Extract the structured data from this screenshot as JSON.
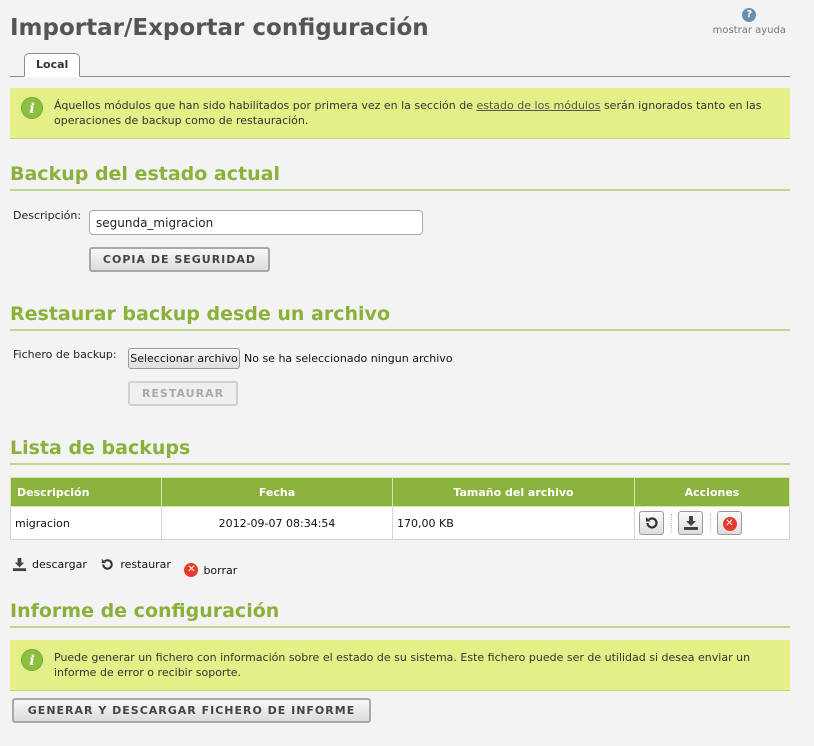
{
  "page": {
    "title": "Importar/Exportar configuración"
  },
  "help": {
    "icon": "help-icon",
    "label": "mostrar ayuda"
  },
  "tabs": [
    {
      "label": "Local"
    }
  ],
  "notice_modules": {
    "icon": "info-icon",
    "text_before": "Áquellos módulos que han sido habilitados por primera vez en la sección de ",
    "link": "estado de los módulos",
    "text_after": " serán ignorados tanto en las operaciones de backup como de restauración."
  },
  "backup": {
    "title": "Backup del estado actual",
    "description_label": "Descripción:",
    "description_value": "segunda_migracion",
    "button": "COPIA DE SEGURIDAD"
  },
  "restore": {
    "title": "Restaurar backup desde un archivo",
    "file_label": "Fichero de backup:",
    "file_button": "Seleccionar archivo",
    "file_status": "No se ha seleccionado ningun archivo",
    "button": "RESTAURAR"
  },
  "backup_list": {
    "title": "Lista de backups",
    "columns": [
      "Descripción",
      "Fecha",
      "Tamaño del archivo",
      "Acciones"
    ],
    "rows": [
      {
        "description": "migracion",
        "date": "2012-09-07 08:34:54",
        "size": "170,00 KB"
      }
    ]
  },
  "legend": {
    "download": "descargar",
    "restore": "restaurar",
    "delete": "borrar"
  },
  "report": {
    "title": "Informe de configuración",
    "notice": "Puede generar un fichero con información sobre el estado de su sistema. Este fichero puede ser de utilidad si desea enviar un informe de error o recibir soporte.",
    "button": "GENERAR Y DESCARGAR FICHERO DE INFORME"
  },
  "colors": {
    "accent": "#8cb23e",
    "notice_bg": "#e4ef88",
    "title": "#8bb13b",
    "delete": "#e53b2c"
  }
}
